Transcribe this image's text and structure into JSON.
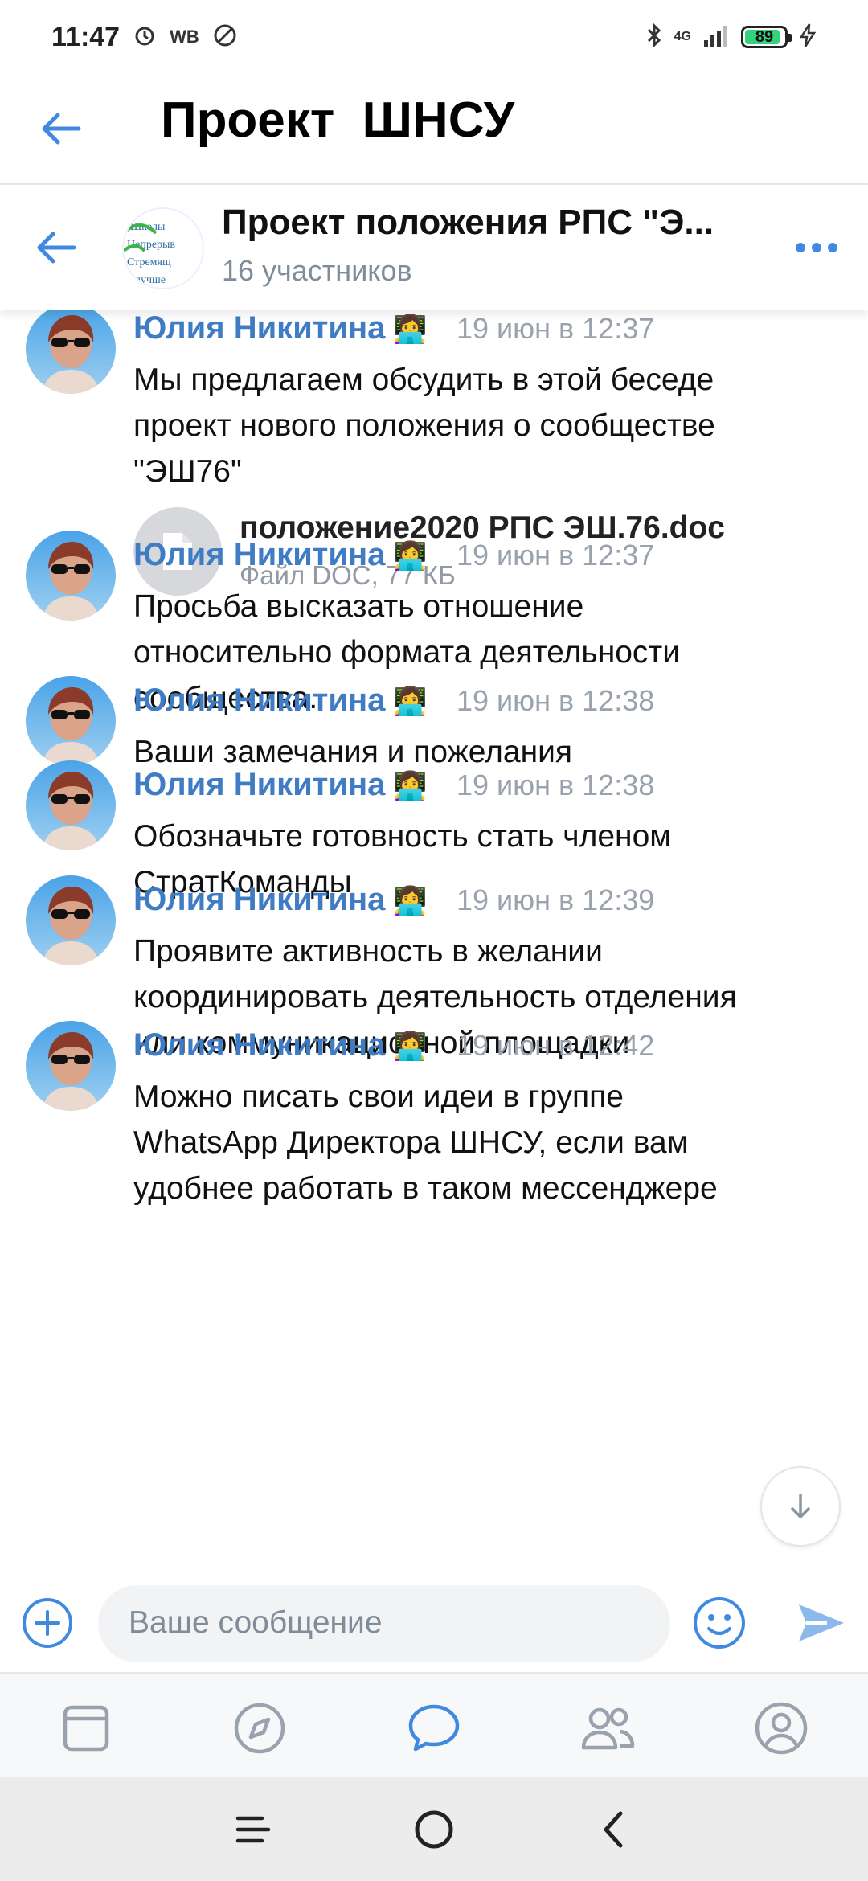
{
  "status_bar": {
    "time": "11:47",
    "carrier_badge": "WB",
    "network": "4G",
    "battery": "89",
    "battery_level": 0.89
  },
  "app_header": {
    "title": "Проект  ШНСУ"
  },
  "chat_header": {
    "title": "Проект положения РПС \"Э...",
    "subtitle": "16 участников",
    "avatar_lines": [
      "Школы",
      "Непрерыв",
      "Стремящ",
      "лучше"
    ]
  },
  "messages": [
    {
      "author": "Юлия Никитина",
      "emoji": "👩‍💻",
      "time": "19 июн в 12:37",
      "lines": [
        "Мы предлагаем обсудить в этой беседе",
        "проект нового положения о сообществе",
        "\"ЭШ76\""
      ],
      "attachment": {
        "name": "положение2020 РПС ЭШ.76.doc",
        "meta": "Файл DOC, 77 КБ"
      }
    },
    {
      "author": "Юлия Никитина",
      "emoji": "👩‍💻",
      "time": "19 июн в 12:37",
      "lines": [
        "Просьба высказать отношение",
        "относительно формата деятельности",
        "сообщества."
      ]
    },
    {
      "author": "Юлия Никитина",
      "emoji": "👩‍💻",
      "time": "19 июн в 12:38",
      "lines": [
        "Ваши замечания и пожелания"
      ]
    },
    {
      "author": "Юлия Никитина",
      "emoji": "👩‍💻",
      "time": "19 июн в 12:38",
      "lines": [
        "Обозначьте готовность стать членом",
        "СтратКоманды"
      ]
    },
    {
      "author": "Юлия Никитина",
      "emoji": "👩‍💻",
      "time": "19 июн в 12:39",
      "lines": [
        "Проявите активность в желании",
        "координировать деятельность отделения",
        "или коммуникационной площадки"
      ]
    },
    {
      "author": "Юлия Никитина",
      "emoji": "👩‍💻",
      "time": "19 июн в 12:42",
      "lines": [
        "Можно писать свои идеи в группе",
        "WhatsApp Директора ШНСУ, если вам",
        "удобнее работать в таком мессенджере"
      ]
    }
  ],
  "composer": {
    "placeholder": "Ваше сообщение"
  },
  "bottom_nav": {
    "tabs": [
      {
        "icon": "news-icon",
        "active": false
      },
      {
        "icon": "discover-icon",
        "active": false
      },
      {
        "icon": "messages-icon",
        "active": true
      },
      {
        "icon": "friends-icon",
        "active": false
      },
      {
        "icon": "profile-icon",
        "active": false
      }
    ]
  },
  "colors": {
    "accent": "#3f8ae0",
    "name_link": "#3f7cc4",
    "secondary_text": "#818c99"
  }
}
